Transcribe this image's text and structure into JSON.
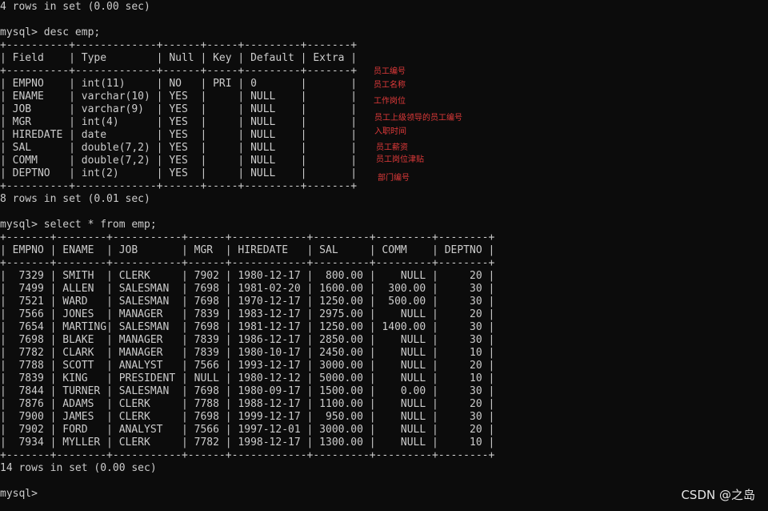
{
  "terminal": {
    "lines": [
      "4 rows in set (0.00 sec)",
      "",
      "mysql> desc emp;",
      "+----------+-------------+------+-----+---------+-------+",
      "| Field    | Type        | Null | Key | Default | Extra |",
      "+----------+-------------+------+-----+---------+-------+",
      "| EMPNO    | int(11)     | NO   | PRI | 0       |       |",
      "| ENAME    | varchar(10) | YES  |     | NULL    |       |",
      "| JOB      | varchar(9)  | YES  |     | NULL    |       |",
      "| MGR      | int(4)      | YES  |     | NULL    |       |",
      "| HIREDATE | date        | YES  |     | NULL    |       |",
      "| SAL      | double(7,2) | YES  |     | NULL    |       |",
      "| COMM     | double(7,2) | YES  |     | NULL    |       |",
      "| DEPTNO   | int(2)      | YES  |     | NULL    |       |",
      "+----------+-------------+------+-----+---------+-------+",
      "8 rows in set (0.01 sec)",
      "",
      "mysql> select * from emp;",
      "+-------+--------+-----------+------+------------+---------+---------+--------+",
      "| EMPNO | ENAME  | JOB       | MGR  | HIREDATE   | SAL     | COMM    | DEPTNO |",
      "+-------+--------+-----------+------+------------+---------+---------+--------+",
      "|  7329 | SMITH  | CLERK     | 7902 | 1980-12-17 |  800.00 |    NULL |     20 |",
      "|  7499 | ALLEN  | SALESMAN  | 7698 | 1981-02-20 | 1600.00 |  300.00 |     30 |",
      "|  7521 | WARD   | SALESMAN  | 7698 | 1970-12-17 | 1250.00 |  500.00 |     30 |",
      "|  7566 | JONES  | MANAGER   | 7839 | 1983-12-17 | 2975.00 |    NULL |     20 |",
      "|  7654 | MARTING| SALESMAN  | 7698 | 1981-12-17 | 1250.00 | 1400.00 |     30 |",
      "|  7698 | BLAKE  | MANAGER   | 7839 | 1986-12-17 | 2850.00 |    NULL |     30 |",
      "|  7782 | CLARK  | MANAGER   | 7839 | 1980-10-17 | 2450.00 |    NULL |     10 |",
      "|  7788 | SCOTT  | ANALYST   | 7566 | 1993-12-17 | 3000.00 |    NULL |     20 |",
      "|  7839 | KING   | PRESIDENT | NULL | 1980-12-12 | 5000.00 |    NULL |     10 |",
      "|  7844 | TURNER | SALESMAN  | 7698 | 1980-09-17 | 1500.00 |    0.00 |     30 |",
      "|  7876 | ADAMS  | CLERK     | 7788 | 1988-12-17 | 1100.00 |    NULL |     20 |",
      "|  7900 | JAMES  | CLERK     | 7698 | 1999-12-17 |  950.00 |    NULL |     30 |",
      "|  7902 | FORD   | ANALYST   | 7566 | 1997-12-01 | 3000.00 |    NULL |     20 |",
      "|  7934 | MYLLER | CLERK     | 7782 | 1998-12-17 | 1300.00 |    NULL |     10 |",
      "+-------+--------+-----------+------+------------+---------+---------+--------+",
      "14 rows in set (0.00 sec)",
      "",
      "mysql>"
    ]
  },
  "annotations": [
    "员工编号",
    "员工名称",
    "工作岗位",
    "员工上级领导的员工编号",
    "入职时间",
    "员工薪资",
    "员工岗位津贴",
    "部门编号"
  ],
  "watermark": "CSDN @之岛",
  "colors": {
    "background": "#0c0c0c",
    "text": "#cccccc",
    "annotation": "#e03a3a"
  }
}
